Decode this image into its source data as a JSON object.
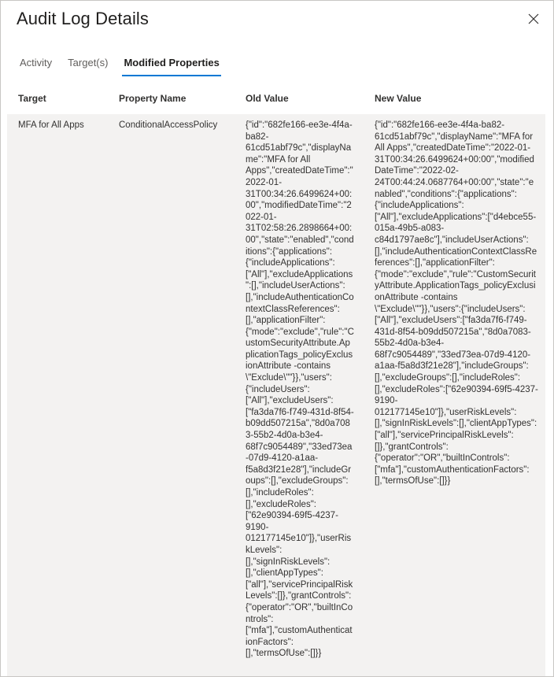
{
  "window": {
    "title": "Audit Log Details",
    "close_icon": "close-icon",
    "close_label": "Close"
  },
  "tabs": [
    {
      "label": "Activity",
      "active": false
    },
    {
      "label": "Target(s)",
      "active": false
    },
    {
      "label": "Modified Properties",
      "active": true
    }
  ],
  "table": {
    "columns": [
      {
        "key": "target",
        "label": "Target"
      },
      {
        "key": "property_name",
        "label": "Property Name"
      },
      {
        "key": "old_value",
        "label": "Old Value"
      },
      {
        "key": "new_value",
        "label": "New Value"
      }
    ],
    "rows": [
      {
        "target": "MFA for All Apps",
        "property_name": "ConditionalAccessPolicy",
        "old_value": "{\"id\":\"682fe166-ee3e-4f4a-ba82-61cd51abf79c\",\"displayName\":\"MFA for All Apps\",\"createdDateTime\":\"2022-01-31T00:34:26.6499624+00:00\",\"modifiedDateTime\":\"2022-01-31T02:58:26.2898664+00:00\",\"state\":\"enabled\",\"conditions\":{\"applications\":{\"includeApplications\":[\"All\"],\"excludeApplications\":[],\"includeUserActions\":[],\"includeAuthenticationContextClassReferences\":[],\"applicationFilter\":{\"mode\":\"exclude\",\"rule\":\"CustomSecurityAttribute.ApplicationTags_policyExclusionAttribute -contains \\\"Exclude\\\"\"}},\"users\":{\"includeUsers\":[\"All\"],\"excludeUsers\":[\"fa3da7f6-f749-431d-8f54-b09dd507215a\",\"8d0a7083-55b2-4d0a-b3e4-68f7c9054489\",\"33ed73ea-07d9-4120-a1aa-f5a8d3f21e28\"],\"includeGroups\":[],\"excludeGroups\":[],\"includeRoles\":[],\"excludeRoles\":[\"62e90394-69f5-4237-9190-012177145e10\"]},\"userRiskLevels\":[],\"signInRiskLevels\":[],\"clientAppTypes\":[\"all\"],\"servicePrincipalRiskLevels\":[]},\"grantControls\":{\"operator\":\"OR\",\"builtInControls\":[\"mfa\"],\"customAuthenticationFactors\":[],\"termsOfUse\":[]}}",
        "new_value": "{\"id\":\"682fe166-ee3e-4f4a-ba82-61cd51abf79c\",\"displayName\":\"MFA for All Apps\",\"createdDateTime\":\"2022-01-31T00:34:26.6499624+00:00\",\"modifiedDateTime\":\"2022-02-24T00:44:24.0687764+00:00\",\"state\":\"enabled\",\"conditions\":{\"applications\":{\"includeApplications\":[\"All\"],\"excludeApplications\":[\"d4ebce55-015a-49b5-a083-c84d1797ae8c\"],\"includeUserActions\":[],\"includeAuthenticationContextClassReferences\":[],\"applicationFilter\":{\"mode\":\"exclude\",\"rule\":\"CustomSecurityAttribute.ApplicationTags_policyExclusionAttribute -contains \\\"Exclude\\\"\"}},\"users\":{\"includeUsers\":[\"All\"],\"excludeUsers\":[\"fa3da7f6-f749-431d-8f54-b09dd507215a\",\"8d0a7083-55b2-4d0a-b3e4-68f7c9054489\",\"33ed73ea-07d9-4120-a1aa-f5a8d3f21e28\"],\"includeGroups\":[],\"excludeGroups\":[],\"includeRoles\":[],\"excludeRoles\":[\"62e90394-69f5-4237-9190-012177145e10\"]},\"userRiskLevels\":[],\"signInRiskLevels\":[],\"clientAppTypes\":[\"all\"],\"servicePrincipalRiskLevels\":[]},\"grantControls\":{\"operator\":\"OR\",\"builtInControls\":[\"mfa\"],\"customAuthenticationFactors\":[],\"termsOfUse\":[]}}"
      }
    ]
  },
  "colors": {
    "accent": "#0078d4",
    "row_background": "#f3f2f1",
    "border": "#c8c6c4",
    "text_primary": "#323130",
    "text_secondary": "#605e5c"
  }
}
